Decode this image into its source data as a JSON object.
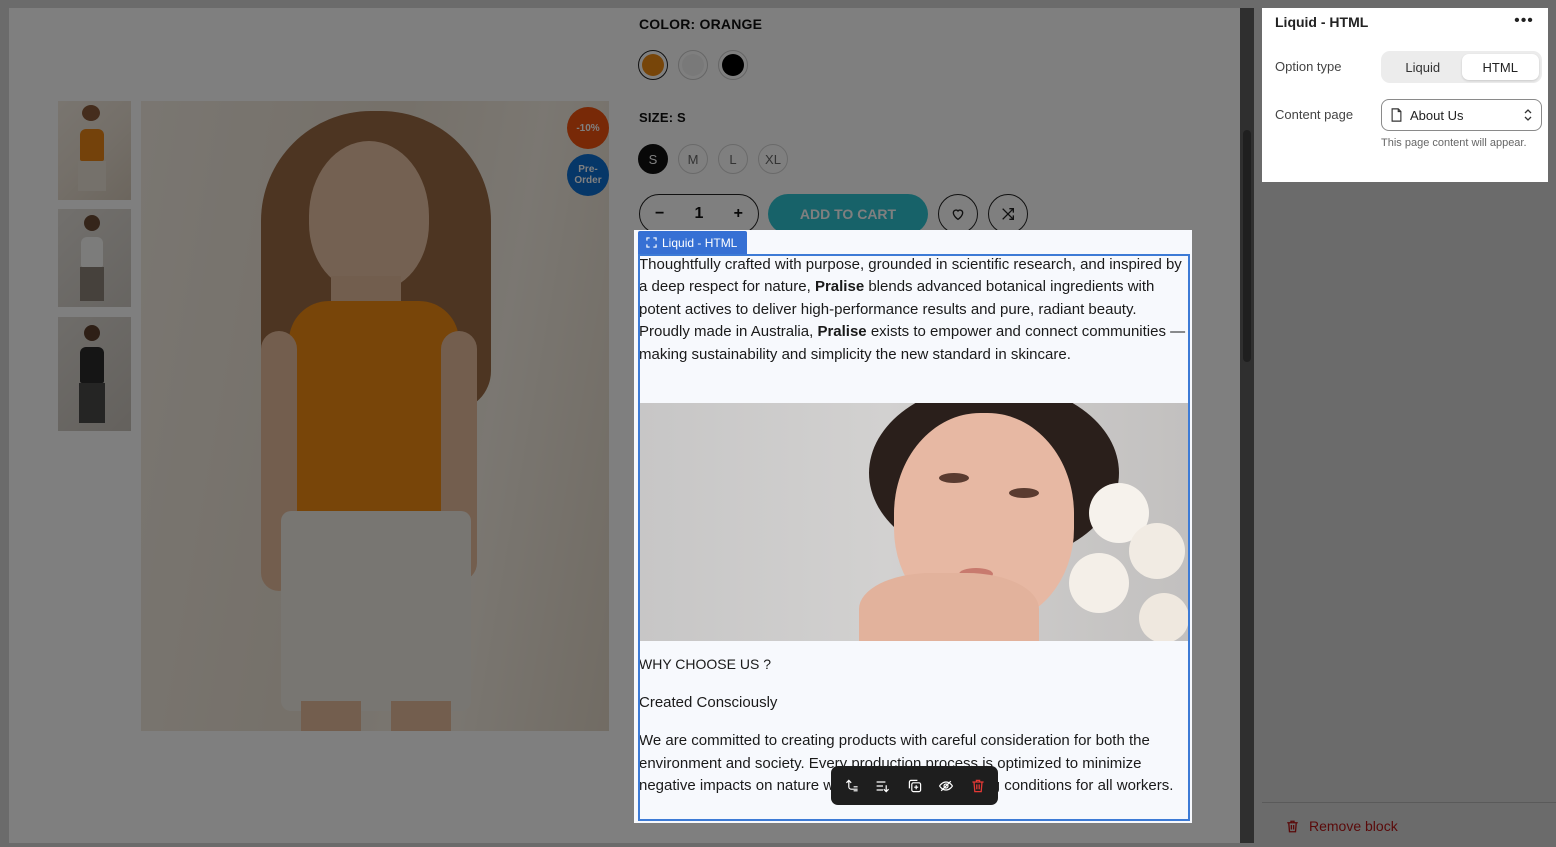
{
  "product": {
    "color_label": "COLOR: ORANGE",
    "size_label": "SIZE: S",
    "sizes": [
      "S",
      "M",
      "L",
      "XL"
    ],
    "quantity": "1",
    "add_to_cart": "ADD TO CART",
    "badge_discount": "-10%",
    "badge_preorder": "Pre-Order",
    "swatch_colors": [
      "#ee8a12",
      "#f3f3f3",
      "#000000"
    ]
  },
  "block": {
    "tag": "Liquid - HTML",
    "intro_1": "Thoughtfully crafted with purpose, grounded in scientific research, and inspired by a deep respect for nature, ",
    "brand": "Pralise",
    "intro_2": " blends advanced botanical ingredients with potent actives to deliver high-performance results and pure, radiant beauty. Proudly made in Australia, ",
    "intro_3": " exists to empower and connect communities — making sustainability and simplicity the new standard in skincare.",
    "why_title": "WHY CHOOSE US ?",
    "created_title": "Created Consciously",
    "body": "We are committed to creating products with careful consideration for both the environment and society. Every production process is optimized to minimize negative impacts on nature while ensuring fair working conditions for all workers."
  },
  "panel": {
    "title": "Liquid - HTML",
    "option_type_label": "Option type",
    "option_liquid": "Liquid",
    "option_html": "HTML",
    "content_page_label": "Content page",
    "content_page_value": "About Us",
    "hint": "This page content will appear.",
    "remove_block": "Remove block"
  },
  "colors": {
    "accent_blue": "#3670d4",
    "cart": "#2fc4d3",
    "danger": "#e53935"
  }
}
